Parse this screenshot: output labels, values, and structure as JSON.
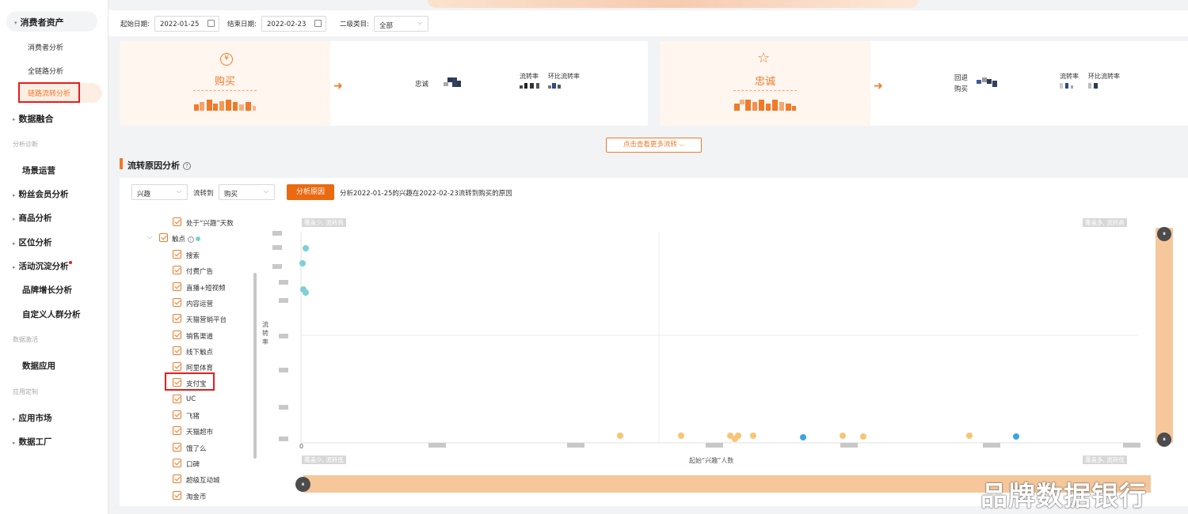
{
  "sidebar": {
    "group_consumer": "消费者资产",
    "sub_items": [
      "消费者分析",
      "全链路分析",
      "链路流转分析"
    ],
    "group_data_fusion": "数据融合",
    "cat_analysis": "分析诊断",
    "items_a": [
      "场景运营",
      "粉丝会员分析",
      "商品分析",
      "区位分析",
      "活动沉淀分析",
      "品牌增长分析",
      "自定义人群分析"
    ],
    "cat_activation": "数据激活",
    "item_data_app": "数据应用",
    "cat_app_custom": "应用定制",
    "items_b": [
      "应用市场",
      "数据工厂"
    ]
  },
  "filters": {
    "start_label": "起始日期:",
    "start_value": "2022-01-25",
    "end_label": "结束日期:",
    "end_value": "2022-02-23",
    "category_label": "二级类目:",
    "category_value": "全部"
  },
  "card1": {
    "icon": "¥",
    "title": "购买",
    "target_label": "忠诚",
    "col1": "流转率",
    "col2": "环比流转率"
  },
  "card2": {
    "icon": "☆",
    "title": "忠诚",
    "target_label_line1": "回退",
    "target_label_line2": "购买",
    "col1": "流转率",
    "col2": "环比流转率"
  },
  "more_button": "点击查看更多流转",
  "section_title": "流转原因分析",
  "analysis": {
    "from_value": "兴趣",
    "to_label": "流转到",
    "to_value": "购买",
    "button": "分析原因",
    "description": "分析2022-01-25的兴趣在2022-02-23流转到购买的原因"
  },
  "factor_list": {
    "first_item": "处于“兴趣”天数",
    "group": "触点",
    "items": [
      "搜索",
      "付费广告",
      "直播+短视频",
      "内容运营",
      "天猫营销平台",
      "销售渠道",
      "线下触点",
      "阿里体育",
      "支付宝",
      "UC",
      "飞猪",
      "天猫超市",
      "饿了么",
      "口碑",
      "超级互动城",
      "淘金币"
    ]
  },
  "chart_data": {
    "type": "scatter",
    "quadrants": {
      "top_left": "覆盖少, 流转高",
      "top_right": "覆盖多, 流转高",
      "bottom_left": "覆盖少, 流转低",
      "bottom_right": "覆盖多, 流转低"
    },
    "ylabel": "流转率",
    "xlabel": "起始“兴趣”人数",
    "x_origin_label": "0",
    "colors": {
      "teal": "#7ecfd6",
      "orange": "#f9c474",
      "blue": "#3ba4e6",
      "accent": "#f07a2a"
    }
  },
  "slider_handle_glyph": "⏸",
  "watermark": "品牌数据银行"
}
